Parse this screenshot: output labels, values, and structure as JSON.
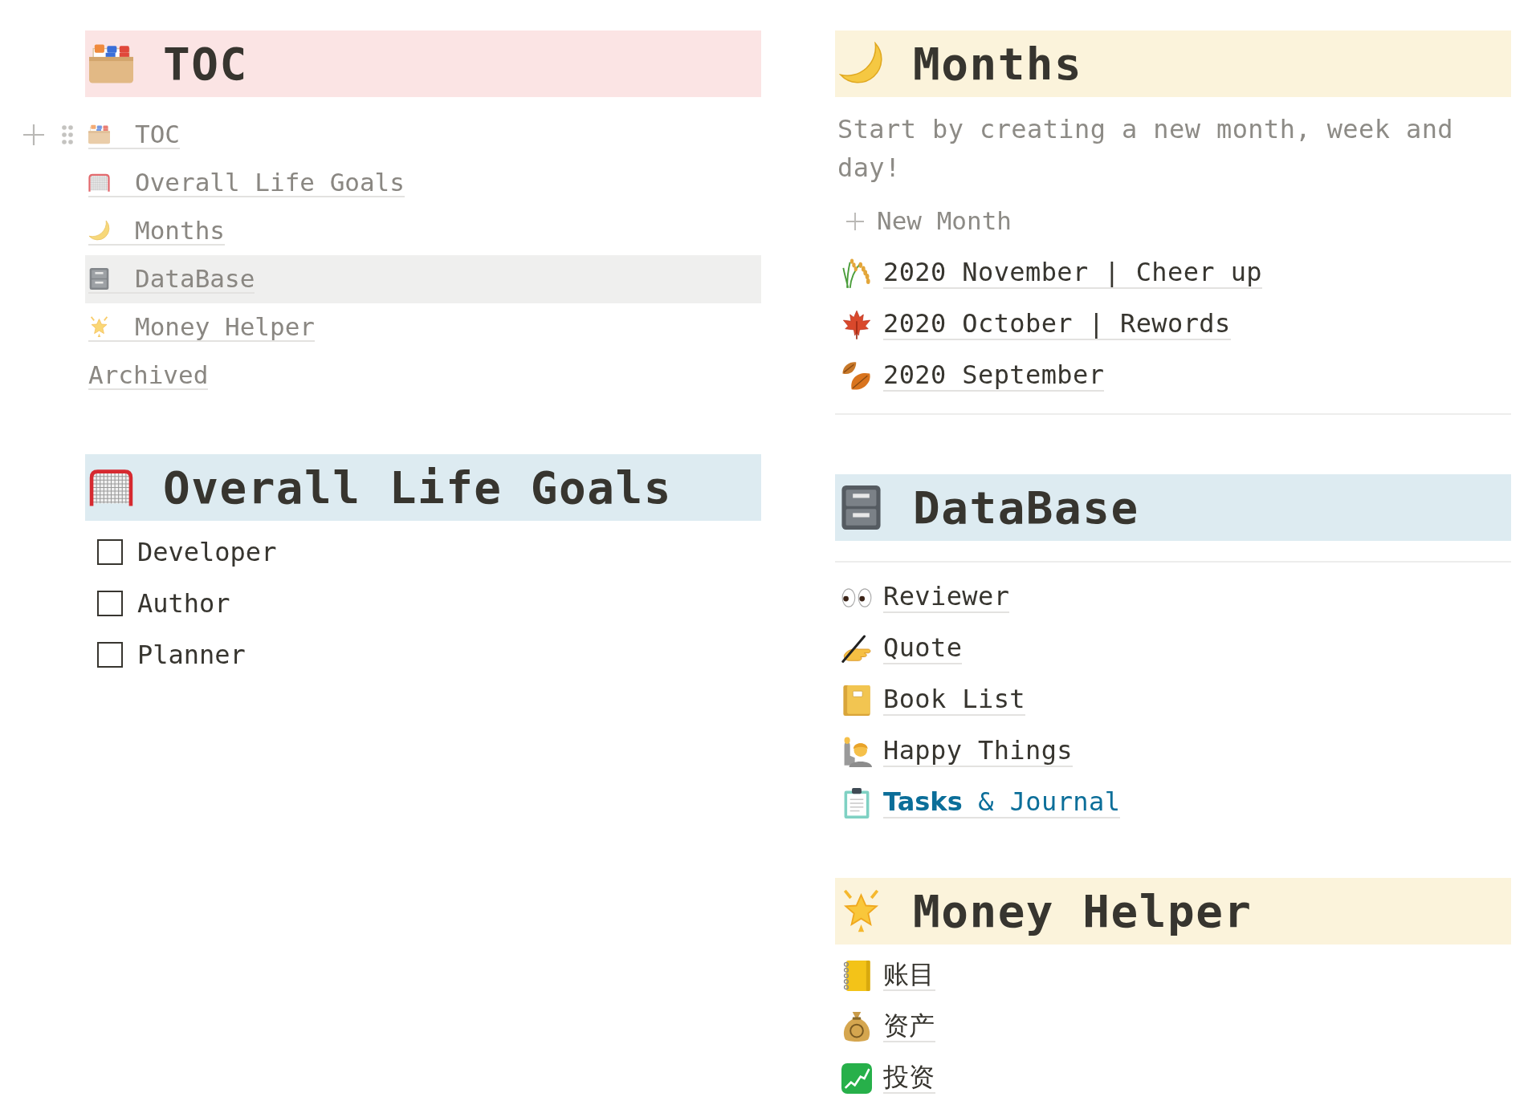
{
  "toc": {
    "heading": "TOC",
    "block_handles": true,
    "links": [
      {
        "text": "TOC",
        "selected": false
      },
      {
        "text": "Overall Life Goals",
        "selected": false
      },
      {
        "text": "Months",
        "selected": false
      },
      {
        "text": "DataBase",
        "selected": true
      },
      {
        "text": "Money Helper",
        "selected": false
      },
      {
        "text": "Archived",
        "selected": false
      }
    ]
  },
  "overall_life_goals": {
    "heading": "Overall Life Goals",
    "todos": [
      {
        "text": "Developer",
        "checked": false
      },
      {
        "text": "Author",
        "checked": false
      },
      {
        "text": "Planner",
        "checked": false
      }
    ]
  },
  "months": {
    "heading": "Months",
    "description": "Start by creating a new month, week and day!",
    "new_button": "New Month",
    "items": [
      "2020 November | Cheer up",
      "2020 October | Rewords",
      "2020 September"
    ]
  },
  "database": {
    "heading": "DataBase",
    "items": [
      {
        "text": "Reviewer",
        "color": "#37352f"
      },
      {
        "text": "Quote",
        "color": "#37352f"
      },
      {
        "text": "Book List",
        "color": "#37352f"
      },
      {
        "text": "Happy Things",
        "color": "#37352f"
      },
      {
        "text": "**Tasks** & Journal",
        "color": "#0b6e99"
      }
    ]
  },
  "money_helper": {
    "heading": "Money Helper",
    "items": [
      "账目",
      "资产",
      "投资"
    ]
  }
}
